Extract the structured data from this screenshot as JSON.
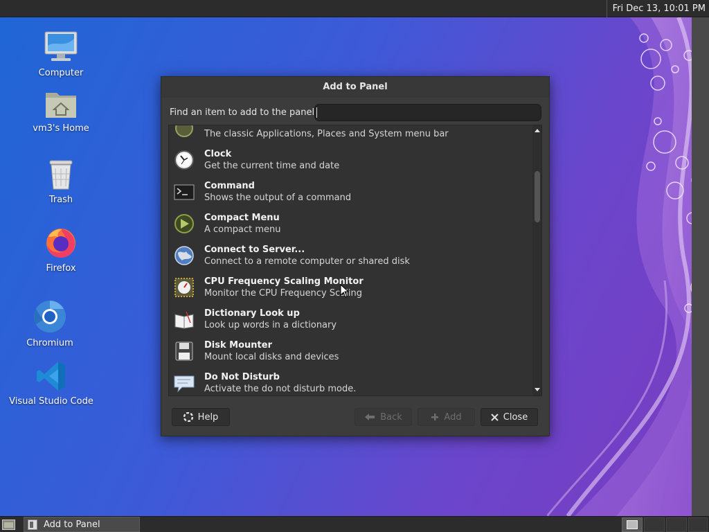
{
  "top_panel": {
    "clock": "Fri Dec 13, 10:01 PM"
  },
  "desktop_icons": [
    {
      "label": "Computer",
      "icon": "computer-icon"
    },
    {
      "label": "vm3's Home",
      "icon": "home-folder-icon"
    },
    {
      "label": "Trash",
      "icon": "trash-icon"
    },
    {
      "label": "Firefox",
      "icon": "firefox-icon"
    },
    {
      "label": "Chromium",
      "icon": "chromium-icon"
    },
    {
      "label": "Visual Studio Code",
      "icon": "vscode-icon"
    }
  ],
  "dialog": {
    "title": "Add to Panel",
    "find_label": "Find an item to add to the panel:",
    "search_value": "",
    "items": [
      {
        "name": "",
        "desc": "The classic Applications, Places and System menu bar",
        "icon": "menu-bar-icon"
      },
      {
        "name": "Clock",
        "desc": "Get the current time and date",
        "icon": "clock-icon"
      },
      {
        "name": "Command",
        "desc": "Shows the output of a command",
        "icon": "terminal-icon"
      },
      {
        "name": "Compact Menu",
        "desc": "A compact menu",
        "icon": "compact-menu-icon"
      },
      {
        "name": "Connect to Server...",
        "desc": "Connect to a remote computer or shared disk",
        "icon": "network-globe-icon"
      },
      {
        "name": "CPU Frequency Scaling Monitor",
        "desc": "Monitor the CPU Frequency Scaling",
        "icon": "cpu-gauge-icon"
      },
      {
        "name": "Dictionary Look up",
        "desc": "Look up words in a dictionary",
        "icon": "dictionary-book-icon"
      },
      {
        "name": "Disk Mounter",
        "desc": "Mount local disks and devices",
        "icon": "floppy-disk-icon"
      },
      {
        "name": "Do Not Disturb",
        "desc": "Activate the do not disturb mode.",
        "icon": "do-not-disturb-icon"
      }
    ],
    "buttons": {
      "help": "Help",
      "back": "Back",
      "add": "Add",
      "close": "Close"
    }
  },
  "taskbar": {
    "window_label": "Add to Panel"
  },
  "colors": {
    "desktop_blue": "#1f66d6",
    "desktop_purple": "#7b3bbf",
    "panel": "#2c2c2c",
    "dialog": "#3c3c3c"
  }
}
